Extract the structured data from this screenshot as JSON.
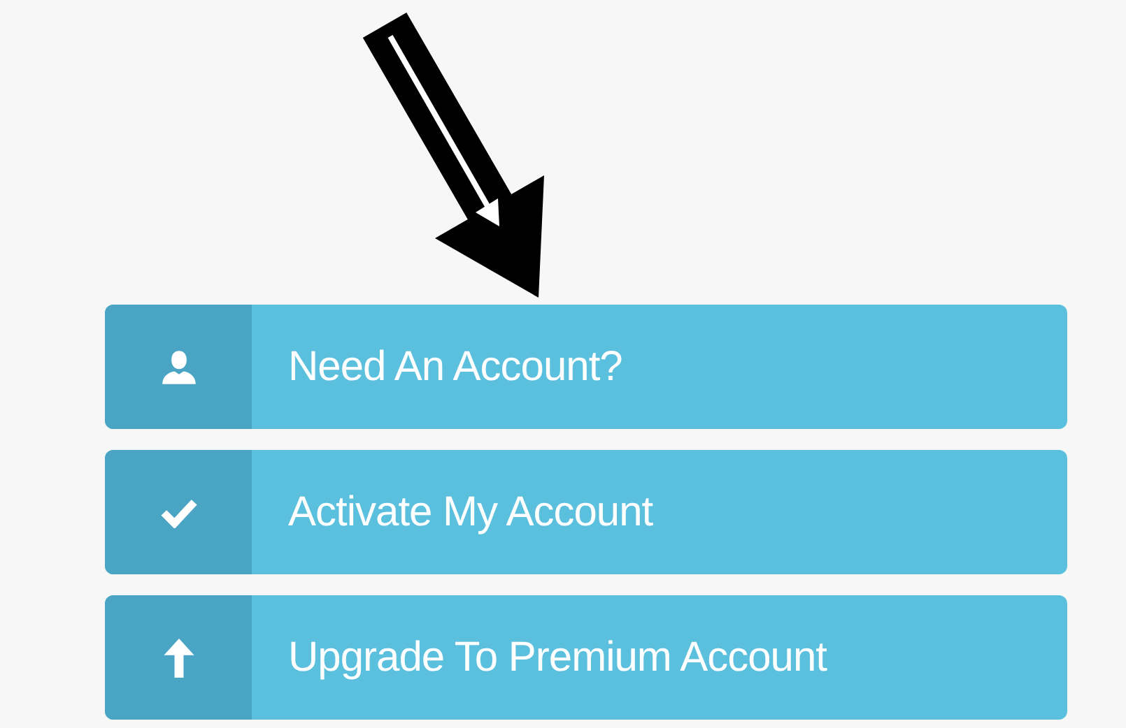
{
  "buttons": [
    {
      "label": "Need An Account?"
    },
    {
      "label": "Activate My Account"
    },
    {
      "label": "Upgrade To Premium Account"
    }
  ]
}
